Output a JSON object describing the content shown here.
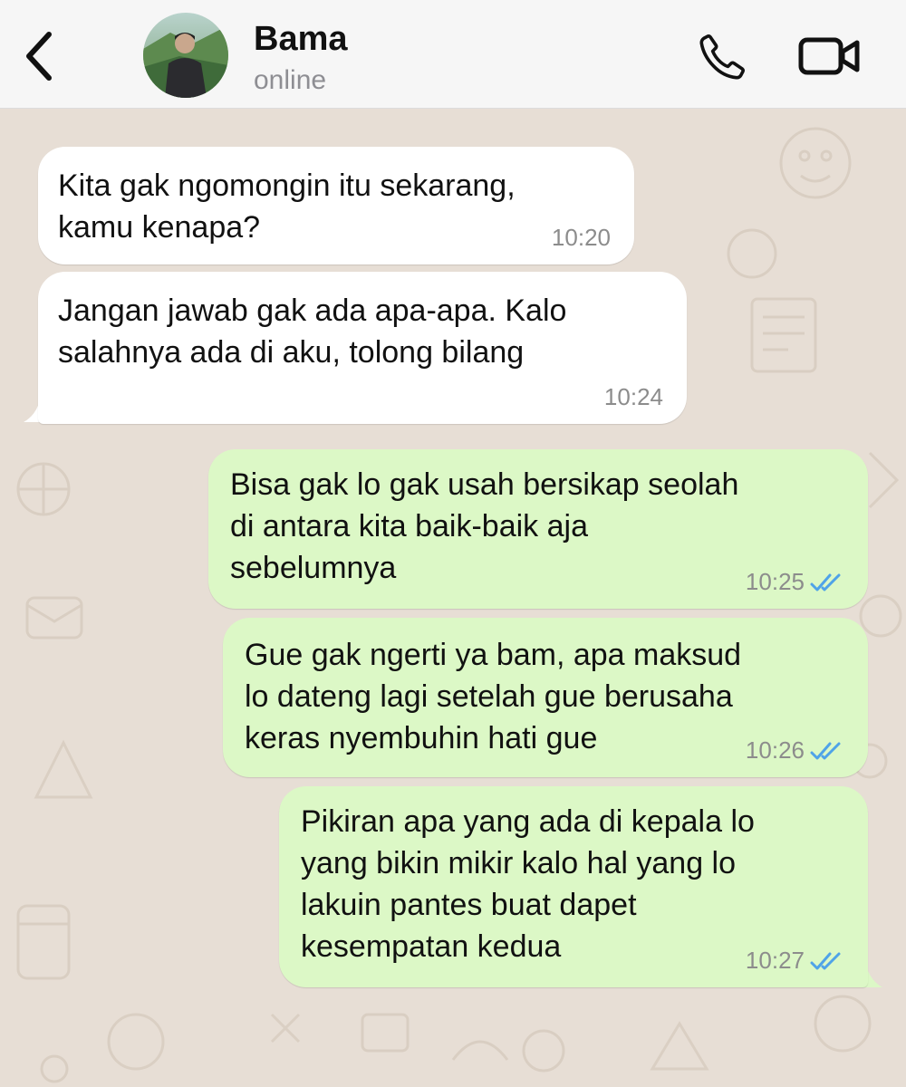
{
  "header": {
    "contact_name": "Bama",
    "status": "online",
    "icons": {
      "back": "chevron-left-icon",
      "call": "phone-icon",
      "video": "video-camera-icon"
    }
  },
  "colors": {
    "header_bg": "#f6f6f6",
    "chat_bg": "#e7ded5",
    "incoming_bubble": "#ffffff",
    "outgoing_bubble": "#dcf8c6",
    "read_ticks": "#4fa3e8",
    "timestamp": "#8c8c8c"
  },
  "messages": [
    {
      "direction": "incoming",
      "text": "Kita gak ngomongin itu sekarang,\nkamu kenapa?",
      "time": "10:20"
    },
    {
      "direction": "incoming",
      "text": "Jangan jawab gak ada apa-apa. Kalo\nsalahnya ada di aku, tolong bilang",
      "time": "10:24"
    },
    {
      "direction": "outgoing",
      "text": "Bisa gak lo gak usah bersikap seolah\ndi antara kita baik-baik aja\nsebelumnya",
      "time": "10:25",
      "status": "read"
    },
    {
      "direction": "outgoing",
      "text": "Gue gak ngerti ya bam, apa maksud\nlo dateng lagi setelah gue berusaha\nkeras nyembuhin hati gue",
      "time": "10:26",
      "status": "read"
    },
    {
      "direction": "outgoing",
      "text": "Pikiran apa yang ada di kepala lo\nyang bikin mikir kalo hal yang lo\nlakuin pantes buat dapet\nkesempatan kedua",
      "time": "10:27",
      "status": "read"
    }
  ]
}
